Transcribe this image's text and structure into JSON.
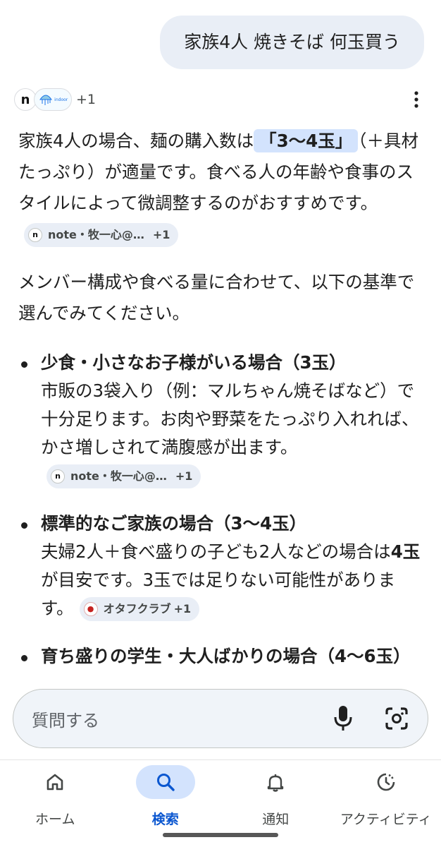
{
  "query": {
    "text": "家族4人 焼きそば 何玉買う"
  },
  "sources_header": {
    "icons": [
      "note-icon",
      "indoor-jellyfish-icon"
    ],
    "logo_text": "indoor",
    "more_count": "+1"
  },
  "answer": {
    "intro": {
      "before": "家族4人の場合、麺の購入数は",
      "highlight": "「3〜4玉」",
      "after": "（＋具材たっぷり）が適量です。食べる人の年齢や食事のスタイルによって微調整するのがおすすめです。",
      "chip": {
        "label": "note・牧一心@…",
        "plus": "+1"
      }
    },
    "lead": "メンバー構成や食べる量に合わせて、以下の基準で選んでみてください。",
    "bullets": [
      {
        "title": "少食・小さなお子様がいる場合（3玉）",
        "body": "市販の3袋入り（例：マルちゃん焼そばなど）で十分足ります。お肉や野菜をたっぷり入れれば、かさ増しされて満腹感が出ます。",
        "chip": {
          "label": "note・牧一心@…",
          "plus": "+1"
        }
      },
      {
        "title": "標準的なご家族の場合（3〜4玉）",
        "body_before": "夫婦2人＋食べ盛りの子ども2人などの場合は",
        "body_bold": "4玉",
        "body_after": "が目安です。3玉では足りない可能性があります。",
        "chip": {
          "label": "オタフクラブ",
          "plus": "+1"
        }
      },
      {
        "title": "育ち盛りの学生・大人ばかりの場合（4〜6玉）"
      }
    ]
  },
  "search_bar": {
    "placeholder": "質問する"
  },
  "nav": {
    "items": [
      {
        "label": "ホーム",
        "icon": "home-icon"
      },
      {
        "label": "検索",
        "icon": "search-icon",
        "active": true
      },
      {
        "label": "通知",
        "icon": "bell-icon"
      },
      {
        "label": "アクティビティ",
        "icon": "activity-icon"
      }
    ]
  },
  "colors": {
    "accent": "#0b57d0",
    "highlight_bg": "#d3e3fd",
    "chip_bg": "#e9eef6",
    "bubble_bg": "#e9eef6"
  }
}
